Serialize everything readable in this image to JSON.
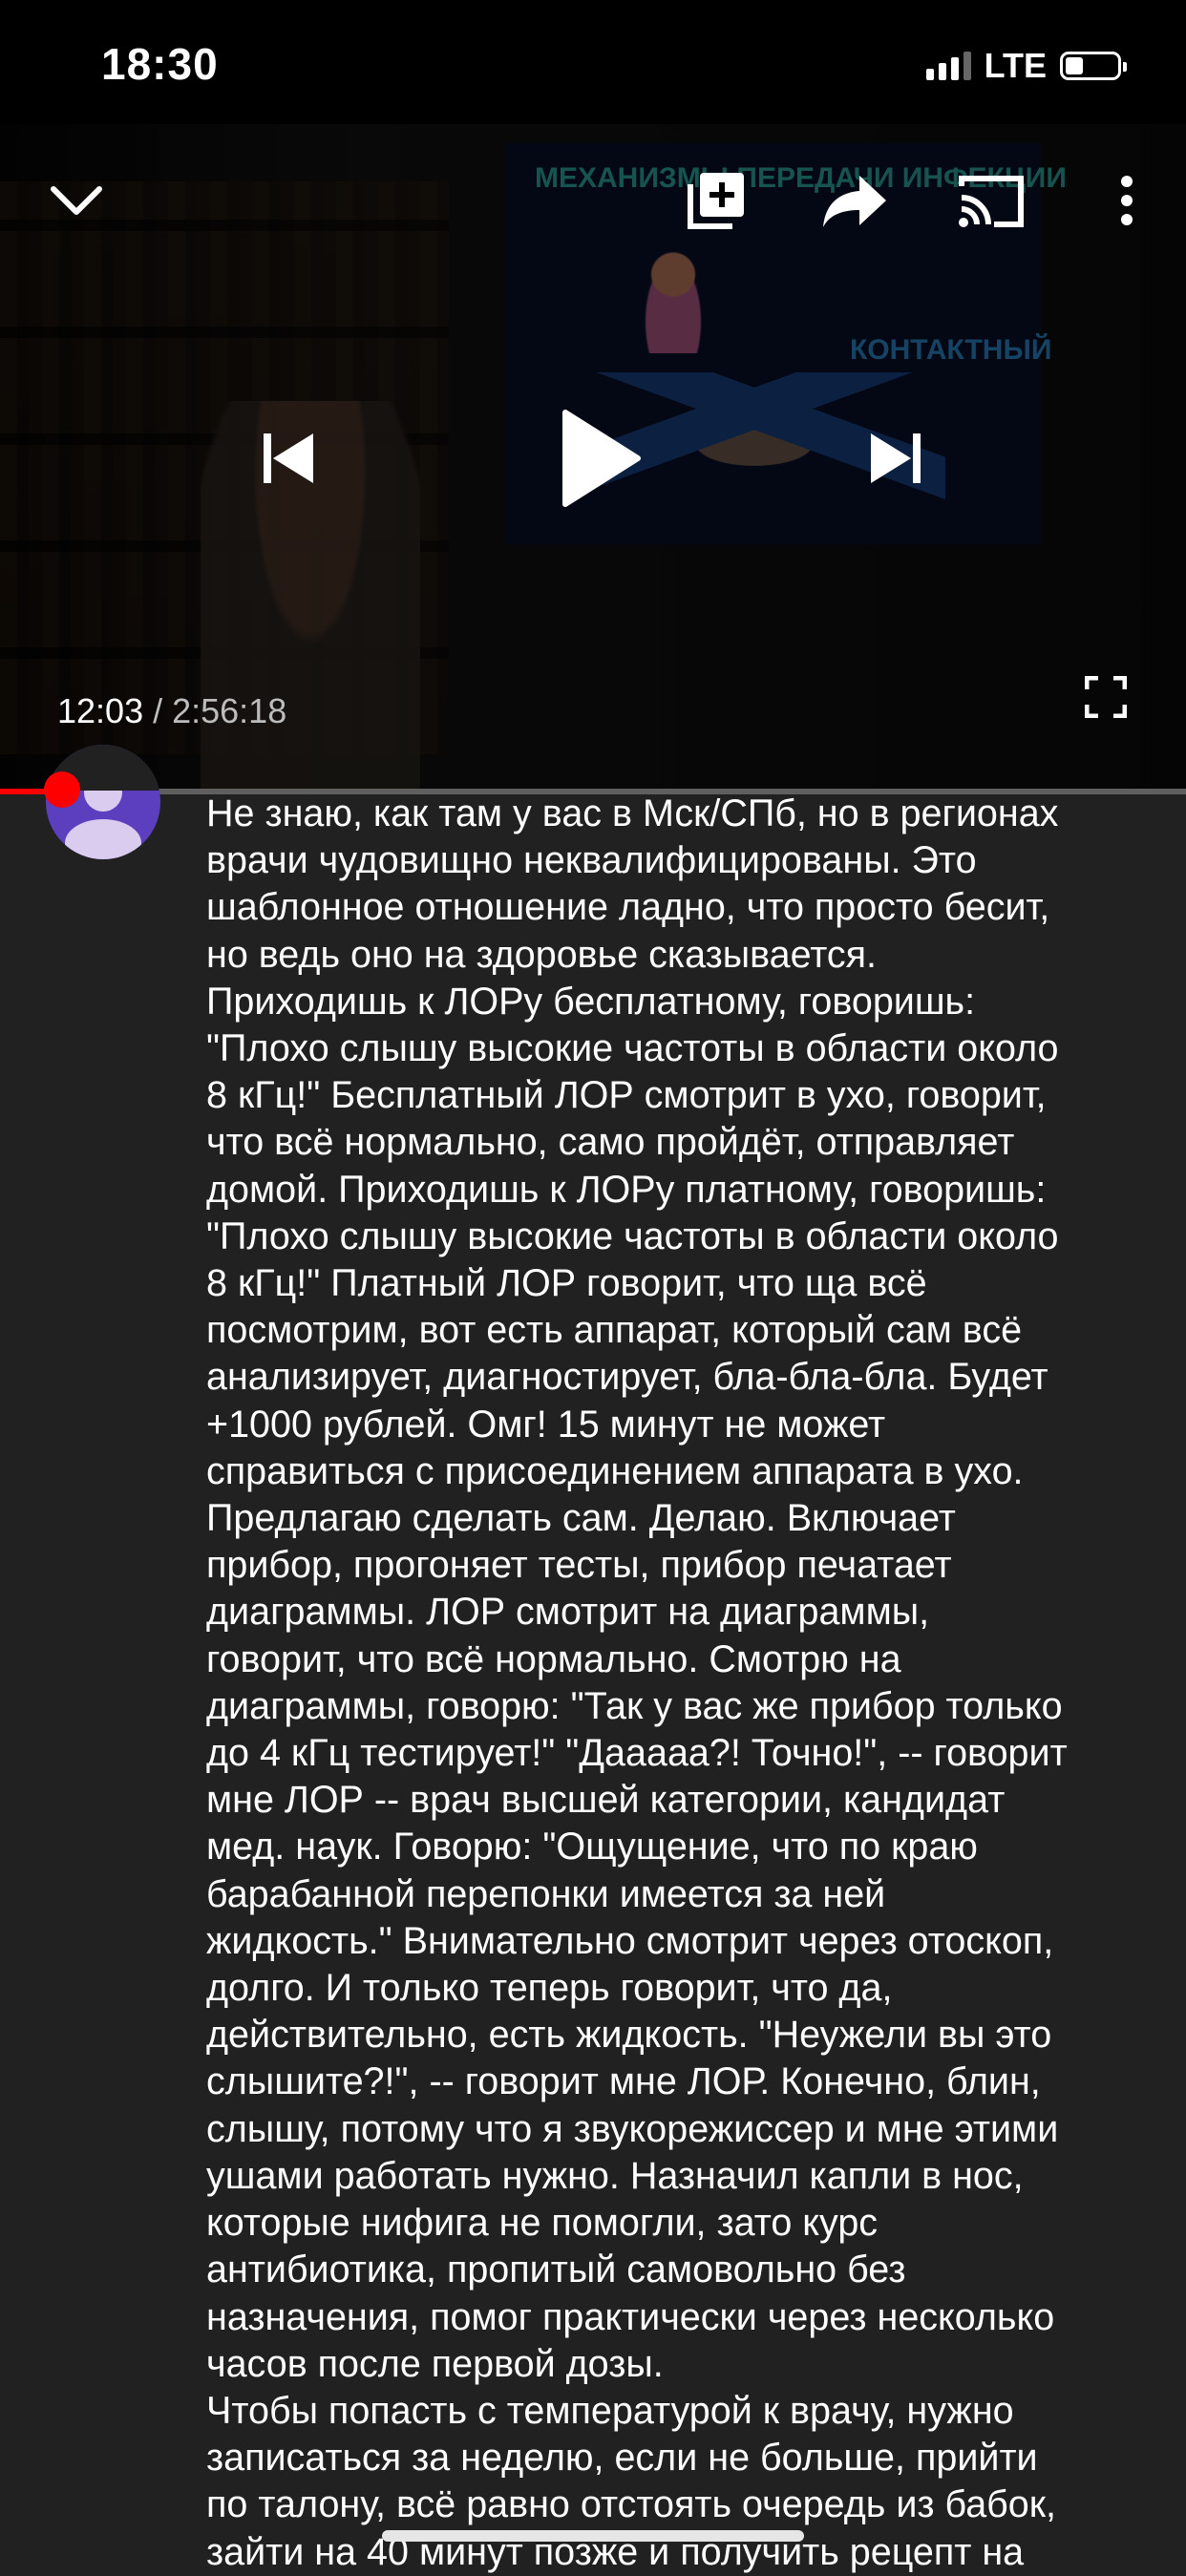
{
  "status_bar": {
    "time": "18:30",
    "network": "LTE",
    "signal_bars": 3,
    "signal_bars_total": 4,
    "battery_level": 0.35
  },
  "player": {
    "current_time": "12:03",
    "total_time": " / 2:56:18",
    "progress": 0.068,
    "slide_title": "МЕХАНИЗМЫ ПЕРЕДАЧИ ИНФЕКЦИИ",
    "slide_label": "КОНТАКТНЫЙ",
    "icons": {
      "collapse": "chevron-down-icon",
      "add": "add-to-playlist-icon",
      "share": "share-icon",
      "cast": "cast-icon",
      "more": "more-vertical-icon",
      "previous": "skip-previous-icon",
      "play": "play-icon",
      "next": "skip-next-icon",
      "fullscreen": "fullscreen-icon"
    }
  },
  "colors": {
    "accent": "#ff0000",
    "background": "#212121",
    "avatar": "#5b3fbf"
  },
  "comment": {
    "text": "Не знаю, как там у вас в Мск/СПб, но в регионах\nврачи чудовищно неквалифицированы. Это\nшаблонное отношение ладно, что просто бесит,\nно ведь оно на здоровье сказывается.\nПриходишь к  ЛОРу бесплатному, говоришь:\n\"Плохо слышу высокие частоты в области около\n8 кГц!\" Бесплатный ЛОР смотрит в ухо, говорит,\nчто всё нормально, само пройдёт, отправляет\nдомой.  Приходишь к ЛОРу платному, говоришь:\n\"Плохо слышу высокие частоты в области около\n8 кГц!\" Платный ЛОР говорит, что ща всё\nпосмотрим, вот есть аппарат, который сам всё\nанализирует, диагностирует, бла-бла-бла. Будет\n+1000 рублей. Омг! 15 минут не может\nсправиться с присоединением аппарата в ухо.\nПредлагаю сделать сам. Делаю. Включает\nприбор, прогоняет тесты, прибор печатает\nдиаграммы. ЛОР смотрит на диаграммы,\nговорит, что всё нормально. Смотрю на\nдиаграммы, говорю: \"Так у вас же прибор только\nдо 4 кГц тестирует!\" \"Дааааа?! Точно!\", -- говорит\nмне ЛОР -- врач высшей категории, кандидат\nмед. наук. Говорю: \"Ощущение, что по краю\nбарабанной перепонки имеется за ней\nжидкость.\" Внимательно смотрит через отоскоп,\nдолго. И только теперь говорит, что да,\nдействительно, есть жидкость. \"Неужели вы это\nслышите?!\", -- говорит мне ЛОР. Конечно, блин,\nслышу, потому что я звукорежиссер и мне этими\nушами работать нужно. Назначил капли в нос,\nкоторые нифига не помогли, зато курс\nантибиотика, пропитый самовольно без\nназначения, помог практически через несколько\nчасов после первой дозы.\nЧтобы попасть с температурой к врачу, нужно\nзаписаться за неделю, если не больше, прийти\nпо талону, всё равно отстоять очередь из бабок,\nзайти на 40 минут позже и получить рецепт на"
  }
}
